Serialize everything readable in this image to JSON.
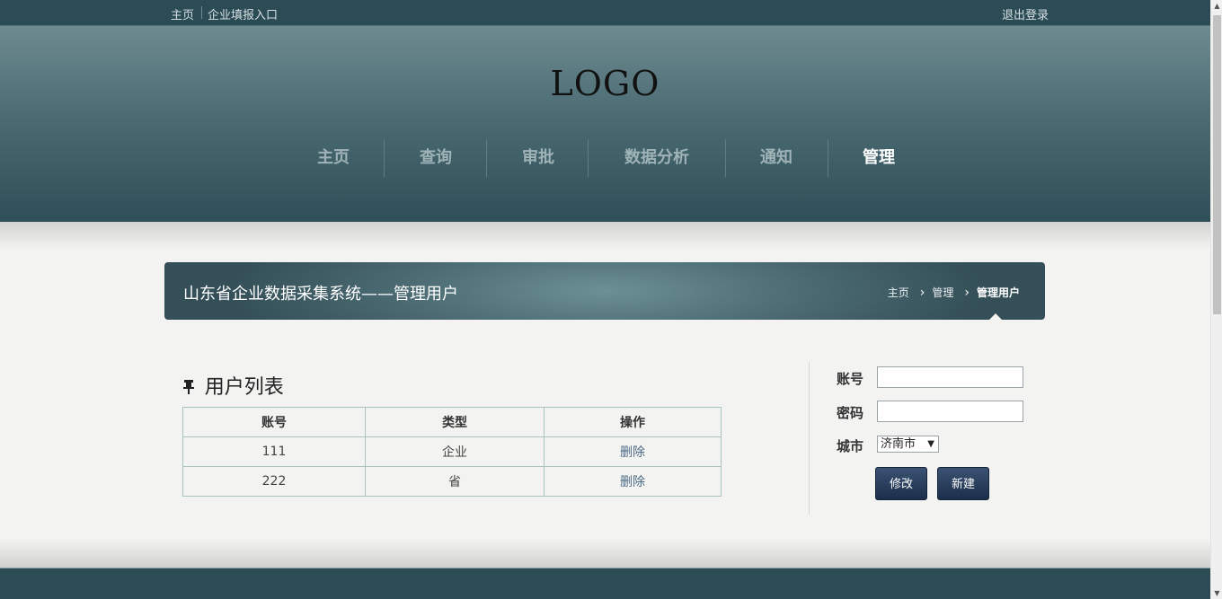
{
  "topbar": {
    "home": "主页",
    "entry": "企业填报入口",
    "logout": "退出登录"
  },
  "logo": "LOGO",
  "nav": [
    {
      "label": "主页"
    },
    {
      "label": "查询"
    },
    {
      "label": "审批"
    },
    {
      "label": "数据分析"
    },
    {
      "label": "通知"
    },
    {
      "label": "管理",
      "active": true
    }
  ],
  "banner": {
    "title": "山东省企业数据采集系统——管理用户",
    "breadcrumb": [
      "主页",
      "管理",
      "管理用户"
    ]
  },
  "user_list": {
    "title": "用户列表",
    "columns": [
      "账号",
      "类型",
      "操作"
    ],
    "rows": [
      {
        "account": "111",
        "type": "企业",
        "action": "删除"
      },
      {
        "account": "222",
        "type": "省",
        "action": "删除"
      }
    ]
  },
  "form": {
    "account_label": "账号",
    "account_value": "",
    "password_label": "密码",
    "password_value": "",
    "city_label": "城市",
    "city_selected": "济南市",
    "modify_button": "修改",
    "new_button": "新建"
  }
}
